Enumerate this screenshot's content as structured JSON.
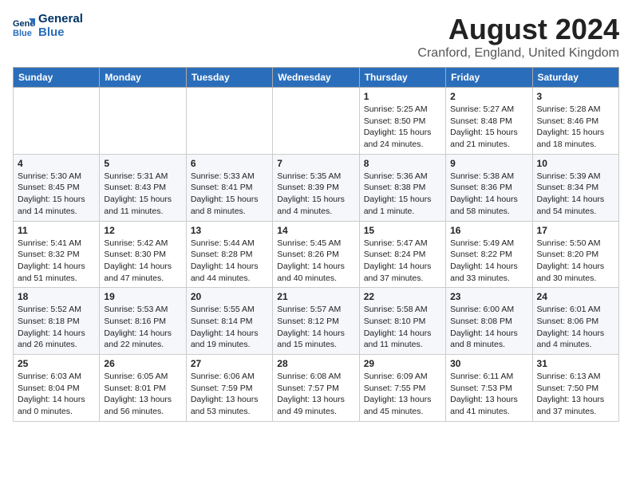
{
  "header": {
    "logo_line1": "General",
    "logo_line2": "Blue",
    "title": "August 2024",
    "subtitle": "Cranford, England, United Kingdom"
  },
  "days_of_week": [
    "Sunday",
    "Monday",
    "Tuesday",
    "Wednesday",
    "Thursday",
    "Friday",
    "Saturday"
  ],
  "weeks": [
    [
      {
        "day": "",
        "info": ""
      },
      {
        "day": "",
        "info": ""
      },
      {
        "day": "",
        "info": ""
      },
      {
        "day": "",
        "info": ""
      },
      {
        "day": "1",
        "info": "Sunrise: 5:25 AM\nSunset: 8:50 PM\nDaylight: 15 hours\nand 24 minutes."
      },
      {
        "day": "2",
        "info": "Sunrise: 5:27 AM\nSunset: 8:48 PM\nDaylight: 15 hours\nand 21 minutes."
      },
      {
        "day": "3",
        "info": "Sunrise: 5:28 AM\nSunset: 8:46 PM\nDaylight: 15 hours\nand 18 minutes."
      }
    ],
    [
      {
        "day": "4",
        "info": "Sunrise: 5:30 AM\nSunset: 8:45 PM\nDaylight: 15 hours\nand 14 minutes."
      },
      {
        "day": "5",
        "info": "Sunrise: 5:31 AM\nSunset: 8:43 PM\nDaylight: 15 hours\nand 11 minutes."
      },
      {
        "day": "6",
        "info": "Sunrise: 5:33 AM\nSunset: 8:41 PM\nDaylight: 15 hours\nand 8 minutes."
      },
      {
        "day": "7",
        "info": "Sunrise: 5:35 AM\nSunset: 8:39 PM\nDaylight: 15 hours\nand 4 minutes."
      },
      {
        "day": "8",
        "info": "Sunrise: 5:36 AM\nSunset: 8:38 PM\nDaylight: 15 hours\nand 1 minute."
      },
      {
        "day": "9",
        "info": "Sunrise: 5:38 AM\nSunset: 8:36 PM\nDaylight: 14 hours\nand 58 minutes."
      },
      {
        "day": "10",
        "info": "Sunrise: 5:39 AM\nSunset: 8:34 PM\nDaylight: 14 hours\nand 54 minutes."
      }
    ],
    [
      {
        "day": "11",
        "info": "Sunrise: 5:41 AM\nSunset: 8:32 PM\nDaylight: 14 hours\nand 51 minutes."
      },
      {
        "day": "12",
        "info": "Sunrise: 5:42 AM\nSunset: 8:30 PM\nDaylight: 14 hours\nand 47 minutes."
      },
      {
        "day": "13",
        "info": "Sunrise: 5:44 AM\nSunset: 8:28 PM\nDaylight: 14 hours\nand 44 minutes."
      },
      {
        "day": "14",
        "info": "Sunrise: 5:45 AM\nSunset: 8:26 PM\nDaylight: 14 hours\nand 40 minutes."
      },
      {
        "day": "15",
        "info": "Sunrise: 5:47 AM\nSunset: 8:24 PM\nDaylight: 14 hours\nand 37 minutes."
      },
      {
        "day": "16",
        "info": "Sunrise: 5:49 AM\nSunset: 8:22 PM\nDaylight: 14 hours\nand 33 minutes."
      },
      {
        "day": "17",
        "info": "Sunrise: 5:50 AM\nSunset: 8:20 PM\nDaylight: 14 hours\nand 30 minutes."
      }
    ],
    [
      {
        "day": "18",
        "info": "Sunrise: 5:52 AM\nSunset: 8:18 PM\nDaylight: 14 hours\nand 26 minutes."
      },
      {
        "day": "19",
        "info": "Sunrise: 5:53 AM\nSunset: 8:16 PM\nDaylight: 14 hours\nand 22 minutes."
      },
      {
        "day": "20",
        "info": "Sunrise: 5:55 AM\nSunset: 8:14 PM\nDaylight: 14 hours\nand 19 minutes."
      },
      {
        "day": "21",
        "info": "Sunrise: 5:57 AM\nSunset: 8:12 PM\nDaylight: 14 hours\nand 15 minutes."
      },
      {
        "day": "22",
        "info": "Sunrise: 5:58 AM\nSunset: 8:10 PM\nDaylight: 14 hours\nand 11 minutes."
      },
      {
        "day": "23",
        "info": "Sunrise: 6:00 AM\nSunset: 8:08 PM\nDaylight: 14 hours\nand 8 minutes."
      },
      {
        "day": "24",
        "info": "Sunrise: 6:01 AM\nSunset: 8:06 PM\nDaylight: 14 hours\nand 4 minutes."
      }
    ],
    [
      {
        "day": "25",
        "info": "Sunrise: 6:03 AM\nSunset: 8:04 PM\nDaylight: 14 hours\nand 0 minutes."
      },
      {
        "day": "26",
        "info": "Sunrise: 6:05 AM\nSunset: 8:01 PM\nDaylight: 13 hours\nand 56 minutes."
      },
      {
        "day": "27",
        "info": "Sunrise: 6:06 AM\nSunset: 7:59 PM\nDaylight: 13 hours\nand 53 minutes."
      },
      {
        "day": "28",
        "info": "Sunrise: 6:08 AM\nSunset: 7:57 PM\nDaylight: 13 hours\nand 49 minutes."
      },
      {
        "day": "29",
        "info": "Sunrise: 6:09 AM\nSunset: 7:55 PM\nDaylight: 13 hours\nand 45 minutes."
      },
      {
        "day": "30",
        "info": "Sunrise: 6:11 AM\nSunset: 7:53 PM\nDaylight: 13 hours\nand 41 minutes."
      },
      {
        "day": "31",
        "info": "Sunrise: 6:13 AM\nSunset: 7:50 PM\nDaylight: 13 hours\nand 37 minutes."
      }
    ]
  ]
}
